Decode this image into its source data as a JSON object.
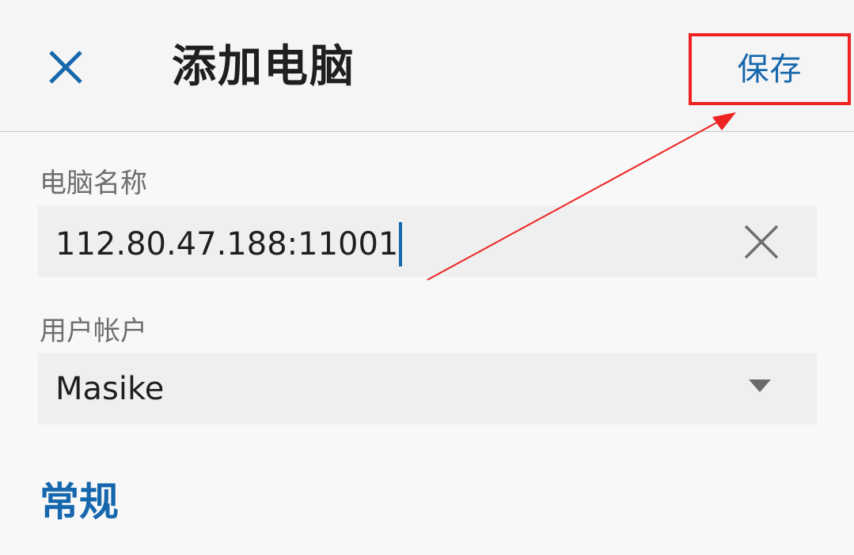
{
  "header": {
    "close_icon": "close-icon",
    "title": "添加电脑",
    "save_label": "保存"
  },
  "form": {
    "computer_name": {
      "label": "电脑名称",
      "value": "112.80.47.188:11001",
      "clear_icon": "clear-icon"
    },
    "user_account": {
      "label": "用户帐户",
      "value": "Masike",
      "dropdown_icon": "chevron-down-icon"
    }
  },
  "section": {
    "general_title": "常规"
  },
  "colors": {
    "accent": "#1667ad",
    "highlight": "#ee2222",
    "background": "#f8f8f8",
    "field_bg": "#efefef"
  }
}
